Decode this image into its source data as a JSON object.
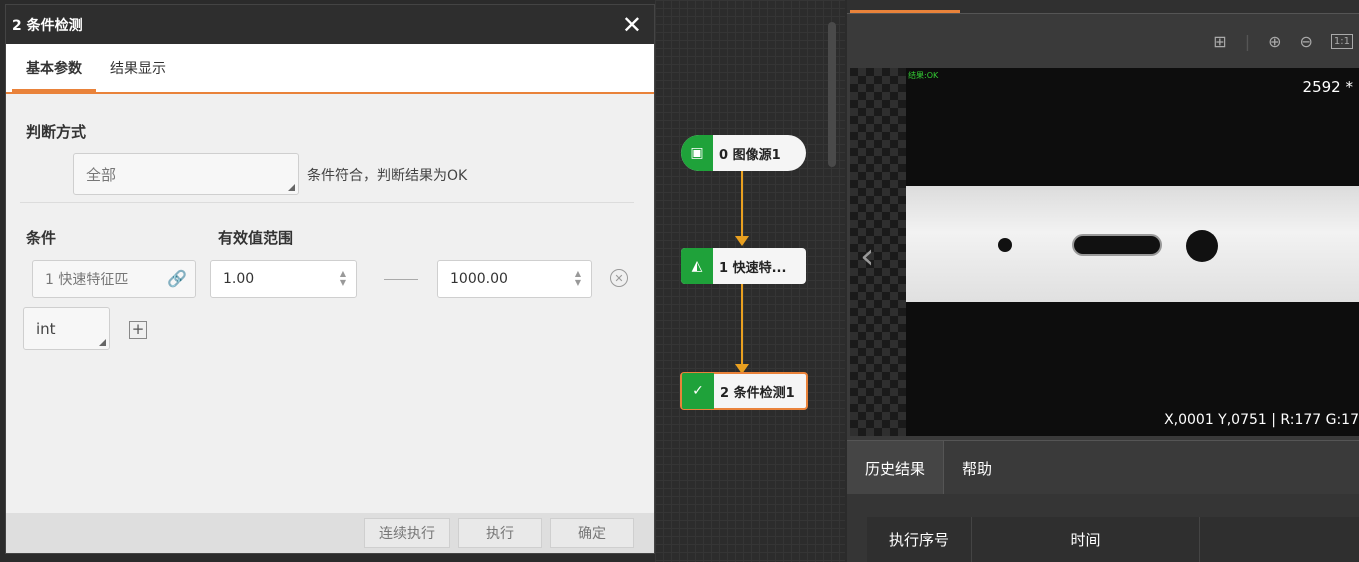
{
  "dialog": {
    "title": "2 条件检测",
    "close_icon": "close-icon",
    "tabs": [
      {
        "label": "基本参数"
      },
      {
        "label": "结果显示"
      }
    ],
    "judge_label": "判断方式",
    "judge_value": "全部",
    "judge_note": "条件符合，判断结果为OK",
    "condition_header": "条件",
    "range_header": "有效值范围",
    "condition_source": "1 快速特征匹",
    "range_min": "1.00",
    "range_max": "1000.00",
    "type_value": "int",
    "footer": {
      "continuous": "连续执行",
      "run": "执行",
      "confirm": "确定"
    }
  },
  "flow": {
    "nodes": [
      {
        "label": "0 图像源1",
        "icon": "image-source-icon"
      },
      {
        "label": "1 快速特...",
        "icon": "feature-match-icon"
      },
      {
        "label": "2 条件检测1",
        "icon": "condition-check-icon"
      }
    ]
  },
  "viewer": {
    "result_text": "结果:OK",
    "image_size": "2592 *",
    "coords": "X,0001  Y,0751  |  R:177  G:17",
    "toolbar_icons": [
      "grid-icon",
      "zoom-in-icon",
      "zoom-out-icon",
      "actual-size-icon"
    ],
    "actual_size_label": "1:1"
  },
  "history": {
    "tabs": [
      {
        "label": "历史结果"
      },
      {
        "label": "帮助"
      }
    ],
    "columns": [
      "执行序号",
      "时间"
    ]
  }
}
